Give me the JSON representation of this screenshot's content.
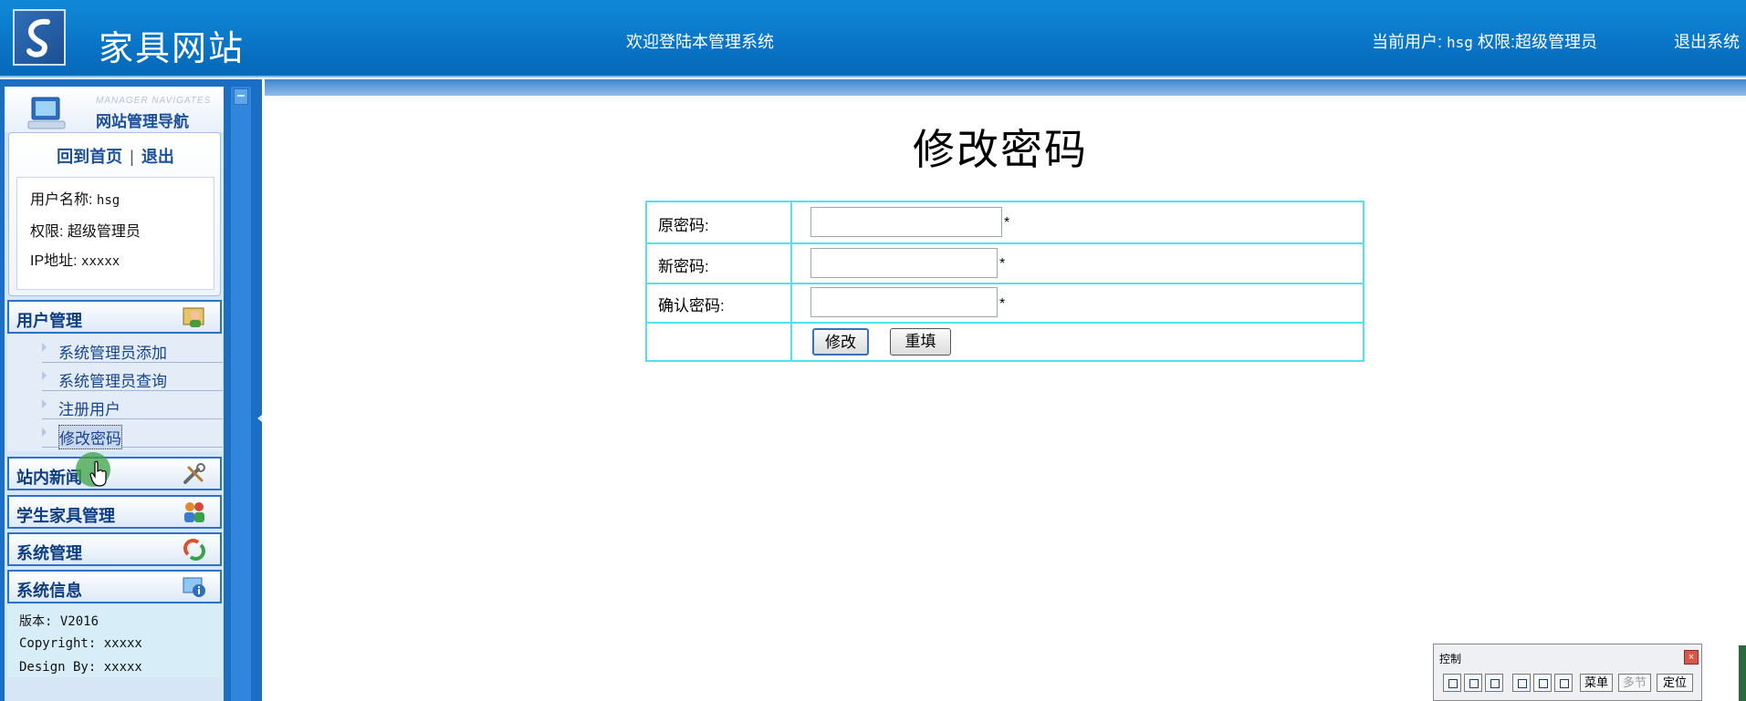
{
  "header": {
    "site_title": "家具网站",
    "welcome": "欢迎登陆本管理系统",
    "current_user_label": "当前用户:",
    "current_user": "hsg",
    "role_label": "权限:",
    "role": "超级管理员",
    "logout": "退出系统"
  },
  "sidebar": {
    "nav_en": "MANAGER NAVIGATES",
    "nav_cn": "网站管理导航",
    "home_link": "回到首页",
    "separator": "|",
    "exit_link": "退出",
    "user_name_label": "用户名称:",
    "user_name": "hsg",
    "role_label": "权限:",
    "role": "超级管理员",
    "ip_label": "IP地址:",
    "ip": "xxxxx",
    "categories": [
      {
        "label": "用户管理",
        "icon": "user-manage-icon"
      },
      {
        "label": "站内新闻",
        "icon": "tools-icon"
      },
      {
        "label": "学生家具管理",
        "icon": "people-icon"
      },
      {
        "label": "系统管理",
        "icon": "refresh-icon"
      },
      {
        "label": "系统信息",
        "icon": "info-icon"
      }
    ],
    "user_submenu": [
      "系统管理员添加",
      "系统管理员查询",
      "注册用户",
      "修改密码"
    ],
    "active_submenu": "修改密码",
    "system_info": {
      "version": "版本:  V2016",
      "copyright": "Copyright: xxxxx",
      "design": "Design By:  xxxxx"
    }
  },
  "main": {
    "page_title": "修改密码",
    "form": {
      "old_password_label": "原密码:",
      "new_password_label": "新密码:",
      "confirm_password_label": "确认密码:",
      "old_password_value": "",
      "new_password_value": "",
      "confirm_password_value": "",
      "required_mark": "*",
      "submit": "修改",
      "reset": "重填"
    }
  },
  "control_panel": {
    "title": "控制",
    "close": "×",
    "menu": "菜单",
    "multi": "多节",
    "locate": "定位"
  },
  "colors": {
    "header_blue": "#0a74c6",
    "table_border": "#54e1ef",
    "nav_text": "#0d3d82"
  }
}
